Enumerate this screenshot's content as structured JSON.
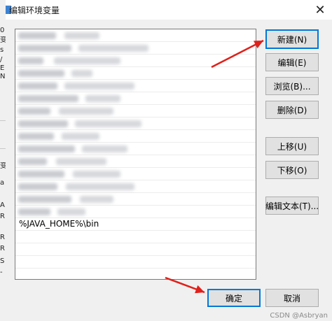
{
  "background_window": {
    "glyphs": [
      "0",
      "变",
      "s",
      "/",
      "E",
      "N",
      "",
      "",
      "",
      "",
      "",
      "变",
      "a",
      "A",
      "R",
      "R",
      "R",
      "S",
      "-"
    ]
  },
  "dialog": {
    "title": "编辑环境变量",
    "close_glyph": "✕",
    "list": {
      "visible_entry": "%JAVA_HOME%\\bin",
      "blurred_row_count": 15
    },
    "buttons": {
      "new": "新建(N)",
      "edit": "编辑(E)",
      "browse": "浏览(B)...",
      "delete": "删除(D)",
      "move_up": "上移(U)",
      "move_down": "下移(O)",
      "edit_text": "编辑文本(T)...",
      "ok": "确定",
      "cancel": "取消"
    }
  },
  "annotations": {
    "arrow_color": "#e0201a"
  },
  "watermark": "CSDN @Asbryan"
}
